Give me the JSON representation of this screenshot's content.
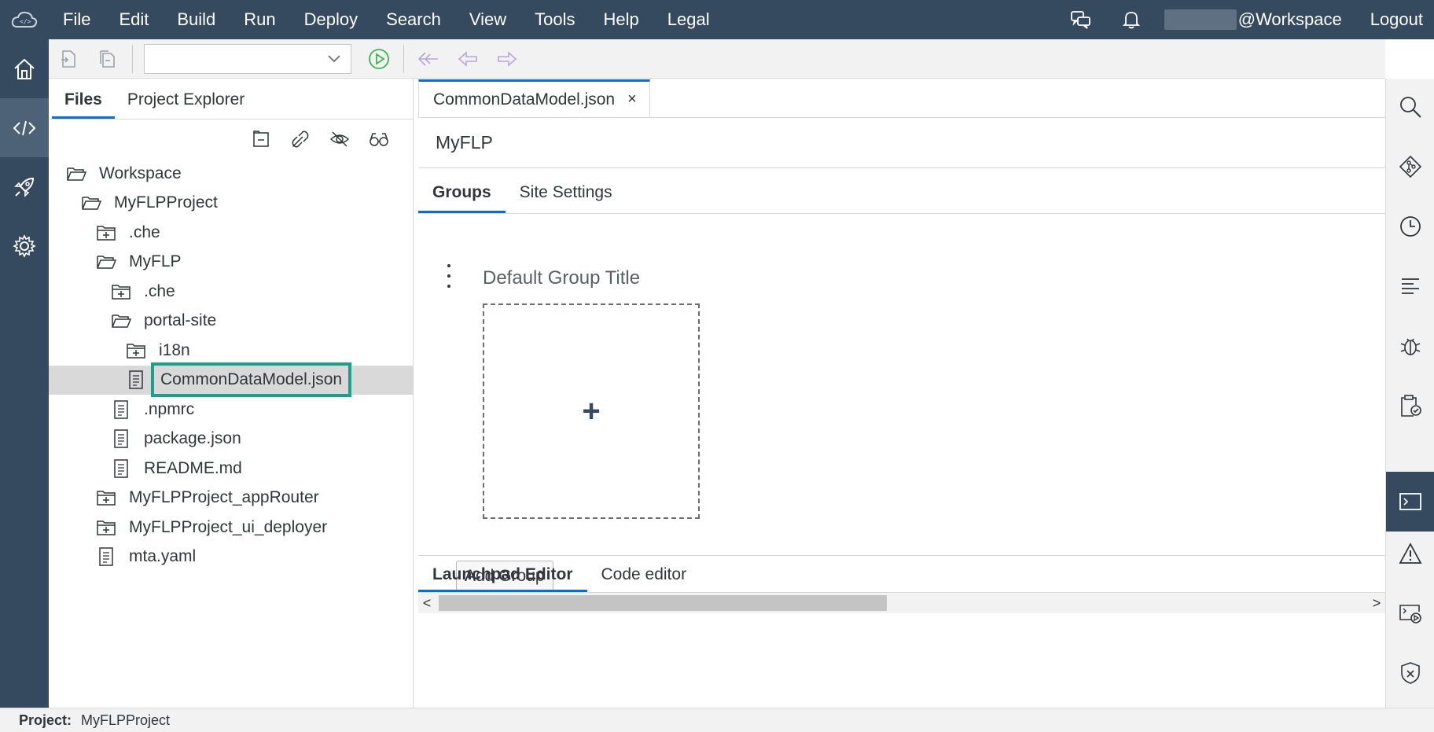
{
  "menubar": {
    "items": [
      "File",
      "Edit",
      "Build",
      "Run",
      "Deploy",
      "Search",
      "View",
      "Tools",
      "Help",
      "Legal"
    ],
    "user_suffix": "@Workspace",
    "logout": "Logout",
    "icons": [
      "cloud-code-logo-icon",
      "feedback-icon",
      "bell-icon"
    ]
  },
  "activitybar": {
    "items": [
      {
        "icon": "home-icon",
        "active": false
      },
      {
        "icon": "code-icon",
        "active": true
      },
      {
        "icon": "rocket-icon",
        "active": false
      },
      {
        "icon": "settings-icon",
        "active": false
      }
    ]
  },
  "toolbar": {
    "run_config_value": "",
    "icons": [
      "new-file-icon",
      "save-all-icon",
      "run-icon",
      "last-edit-icon",
      "back-icon",
      "forward-icon"
    ]
  },
  "leftpanel": {
    "tabs": [
      "Files",
      "Project Explorer"
    ],
    "active_tab": "Files",
    "tools": [
      "collapse-all-icon",
      "link-editor-icon",
      "hide-hidden-files-icon",
      "preview-icon"
    ],
    "tree": [
      {
        "label": "Workspace",
        "type": "folder-open",
        "level": 0
      },
      {
        "label": "MyFLPProject",
        "type": "folder-open",
        "level": 1
      },
      {
        "label": ".che",
        "type": "folder-closed",
        "level": 2
      },
      {
        "label": "MyFLP",
        "type": "folder-open",
        "level": 2
      },
      {
        "label": ".che",
        "type": "folder-closed",
        "level": 3
      },
      {
        "label": "portal-site",
        "type": "folder-open",
        "level": 3
      },
      {
        "label": "i18n",
        "type": "folder-closed",
        "level": 4
      },
      {
        "label": "CommonDataModel.json",
        "type": "file",
        "level": 4,
        "selected": true,
        "highlighted": true
      },
      {
        "label": ".npmrc",
        "type": "file",
        "level": 3
      },
      {
        "label": "package.json",
        "type": "file",
        "level": 3
      },
      {
        "label": "README.md",
        "type": "file",
        "level": 3
      },
      {
        "label": "MyFLPProject_appRouter",
        "type": "folder-closed",
        "level": 2
      },
      {
        "label": "MyFLPProject_ui_deployer",
        "type": "folder-closed",
        "level": 2
      },
      {
        "label": "mta.yaml",
        "type": "file",
        "level": 2
      }
    ]
  },
  "editor": {
    "tab_label": "CommonDataModel.json",
    "close_glyph": "×",
    "title": "MyFLP",
    "sub_tabs": [
      "Groups",
      "Site Settings"
    ],
    "active_sub_tab": "Groups",
    "group_title": "Default Group Title",
    "add_tile_glyph": "+",
    "add_group_label": "Add Group",
    "bottom_tabs": [
      "Launchpad Editor",
      "Code editor"
    ],
    "active_bottom_tab": "Launchpad Editor",
    "scroll_left": "<",
    "scroll_right": ">"
  },
  "rightbar": {
    "icons": [
      "search-icon",
      "git-icon",
      "history-icon",
      "outline-icon",
      "debugger-icon",
      "checklist-icon",
      "console-icon",
      "problems-icon",
      "run-console-icon",
      "security-icon"
    ]
  },
  "statusbar": {
    "label": "Project:",
    "value": "MyFLPProject"
  },
  "colors": {
    "shell": "#354a5f",
    "accent": "#0a6ed1",
    "highlight_box": "#1aa08b",
    "run_green": "#3fb34f"
  }
}
